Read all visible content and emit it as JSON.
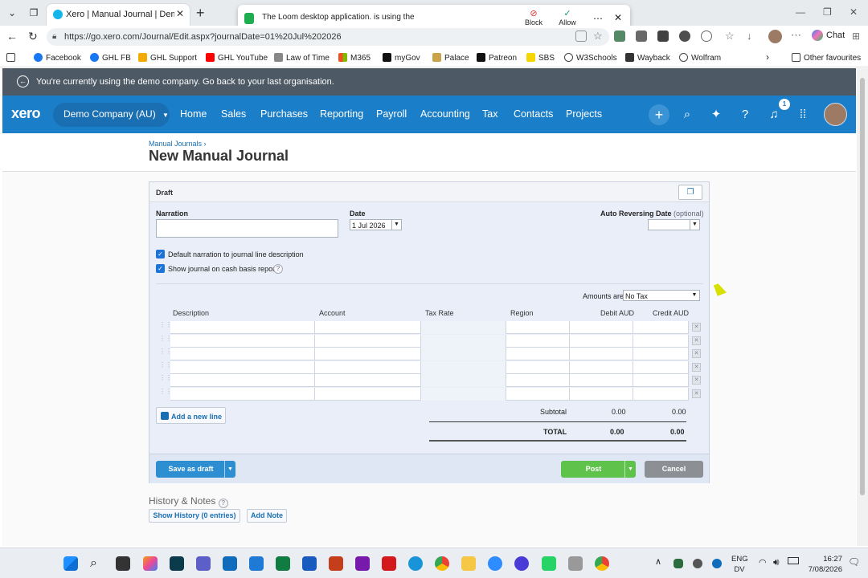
{
  "browser": {
    "tab_title": "Xero | Manual Journal | Demo Co",
    "popup_message": "The Loom desktop application. is using the mic",
    "popup_block": "Block",
    "popup_allow": "Allow",
    "url": "https://go.xero.com/Journal/Edit.aspx?journalDate=01%20Jul%202026",
    "chat_label": "Chat",
    "bookmarks": [
      "Facebook",
      "GHL FB",
      "GHL Support",
      "GHL YouTube",
      "Law of Time",
      "M365",
      "myGov",
      "Palace",
      "Patreon",
      "SBS",
      "W3Schools",
      "Wayback",
      "Wolfram"
    ],
    "other_favourites": "Other favourites"
  },
  "demo_banner": "You're currently using the demo company. Go back to your last organisation.",
  "xero_nav": {
    "logo": "xero",
    "org": "Demo Company (AU)",
    "menu": [
      "Home",
      "Sales",
      "Purchases",
      "Reporting",
      "Payroll",
      "Accounting",
      "Tax",
      "Contacts",
      "Projects"
    ],
    "notification_count": "1"
  },
  "page": {
    "breadcrumb": "Manual Journals ›",
    "title": "New Manual Journal"
  },
  "journal": {
    "status": "Draft",
    "narration_label": "Narration",
    "date_label": "Date",
    "date_value": "1 Jul 2026",
    "auto_reversing_label": "Auto Reversing Date",
    "auto_reversing_optional": "(optional)",
    "default_narration_text": "Default narration to journal line description",
    "cash_basis_text": "Show journal on cash basis reports",
    "amounts_are_label": "Amounts are",
    "amounts_are_value": "No Tax",
    "columns": [
      "Description",
      "Account",
      "Tax Rate",
      "Region",
      "Debit AUD",
      "Credit AUD"
    ],
    "add_line": "Add a new line",
    "subtotal_label": "Subtotal",
    "subtotal_debit": "0.00",
    "subtotal_credit": "0.00",
    "total_label": "TOTAL",
    "total_debit": "0.00",
    "total_credit": "0.00",
    "save_draft": "Save as draft",
    "post": "Post",
    "cancel": "Cancel"
  },
  "history": {
    "title": "History & Notes",
    "show_history": "Show History (0 entries)",
    "add_note": "Add Note"
  },
  "taskbar": {
    "lang_1": "ENG",
    "lang_2": "DV",
    "time": "16:27",
    "date": "7/08/2026"
  }
}
